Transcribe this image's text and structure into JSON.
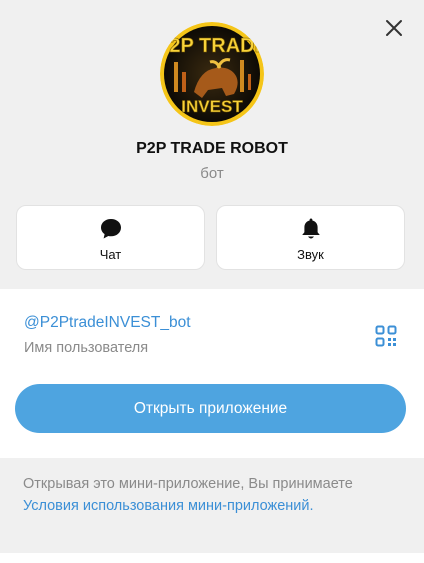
{
  "profile": {
    "name": "P2P TRADE ROBOT",
    "type": "бот",
    "avatar_text_top": "P2P TRADE",
    "avatar_text_bottom": "INVEST",
    "avatar_icon": "bull-logo"
  },
  "actions": [
    {
      "label": "Чат",
      "icon": "chat-bubble-icon"
    },
    {
      "label": "Звук",
      "icon": "bell-icon"
    }
  ],
  "info": {
    "username": "@P2PtradeINVEST_bot",
    "username_caption": "Имя пользователя",
    "qr_icon": "qr-code-icon"
  },
  "open_app_label": "Открыть приложение",
  "terms": {
    "text_prefix": "Открывая это мини-приложение, Вы принимаете ",
    "link_text": "Условия использования мини-приложений."
  },
  "colors": {
    "accent": "#4ea4e0",
    "link": "#3b8fd6",
    "background": "#f0f0f0"
  }
}
